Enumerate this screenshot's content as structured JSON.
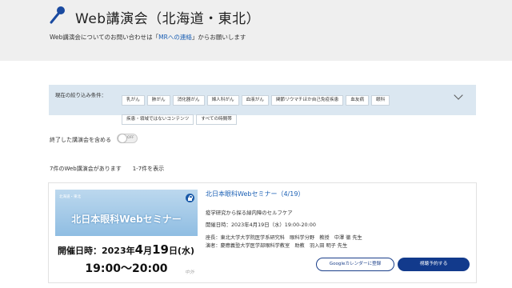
{
  "header": {
    "title": "Web講演会（北海道・東北）",
    "subtitle_pre": "Web講演会についてのお問い合わせは「",
    "subtitle_link": "MRへの連絡",
    "subtitle_post": "」からお願いします",
    "icon": "microphone-icon"
  },
  "filter": {
    "label": "現在の絞り込み条件：",
    "tags": [
      "乳がん",
      "肺がん",
      "消化器がん",
      "婦人科がん",
      "血液がん",
      "関節リウマチほか自己免疫疾患",
      "血友病",
      "眼科",
      "疾患・領域ではないコンテンツ",
      "すべての時間帯"
    ]
  },
  "toggle": {
    "label": "終了した講演会を含める",
    "state": "OFF"
  },
  "results": {
    "count_text": "7件のWeb講演会があります",
    "range_text": "1-7件を表示"
  },
  "event": {
    "banner_region": "北海道・東北",
    "banner_title": "北日本眼科Webセミナー",
    "banner_date_prefix": "開催日時：2023年",
    "banner_month": "4",
    "banner_month_suffix": "月",
    "banner_day": "19",
    "banner_day_suffix": "日(水)",
    "banner_time": "19:00〜20:00",
    "banner_logo": "中外",
    "title": "北日本眼科Webセミナー（4/19）",
    "subtitle": "疫学研究から探る緑内障のセルフケア",
    "date": "開催日時：2023年4月19日（水）19:00-20:00",
    "chair": "座長：東北大学大学院医学系研究科　眼科学分野　教授　中澤 徹 先生",
    "speaker": "演者：慶應義塾大学医学部眼科学教室　助教　羽入田 明子 先生",
    "calendar_button": "Googleカレンダーに登録",
    "register_button": "視聴予約する"
  },
  "colors": {
    "accent": "#1a5fb4",
    "button_primary": "#123a8c",
    "filter_bg": "#dbe7f1"
  }
}
